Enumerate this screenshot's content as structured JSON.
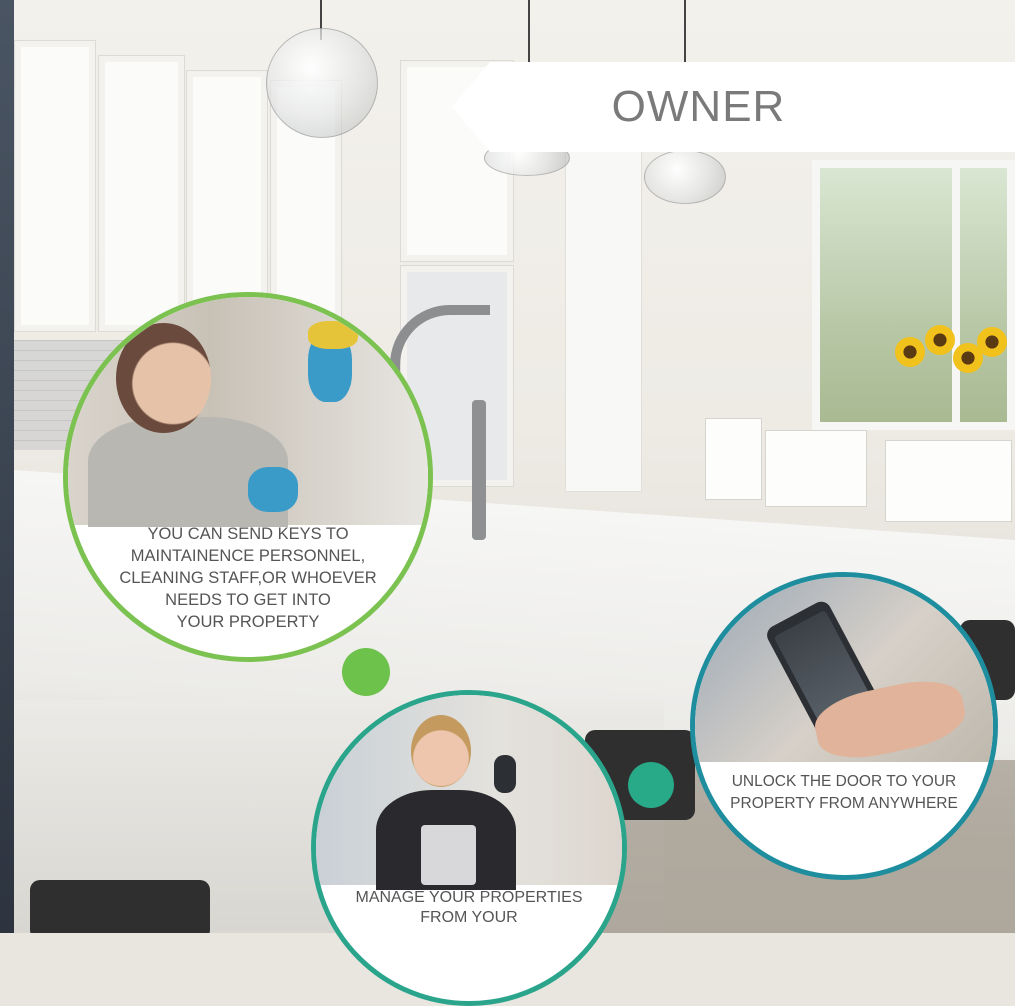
{
  "banner": {
    "title": "OWNER"
  },
  "features": [
    {
      "caption_lines": [
        "YOU CAN SEND KEYS TO",
        "MAINTAINENCE PERSONNEL,",
        "CLEANING STAFF,OR WHOEVER",
        "NEEDS TO GET INTO",
        "YOUR PROPERTY"
      ],
      "accent": "#7cc251",
      "icon": "cleaning-person-photo"
    },
    {
      "caption_lines": [
        "MANAGE YOUR PROPERTIES",
        "FROM YOUR"
      ],
      "accent": "#2aa58c",
      "icon": "woman-with-phone-photo"
    },
    {
      "caption_lines": [
        "UNLOCK THE DOOR TO YOUR",
        "PROPERTY FROM ANYWHERE"
      ],
      "accent": "#1e8e9e",
      "icon": "smartphone-app-photo"
    }
  ],
  "colors": {
    "green_dot": "#6cc24a",
    "teal_dot": "#28a987",
    "banner_text": "#7a7a7a"
  }
}
